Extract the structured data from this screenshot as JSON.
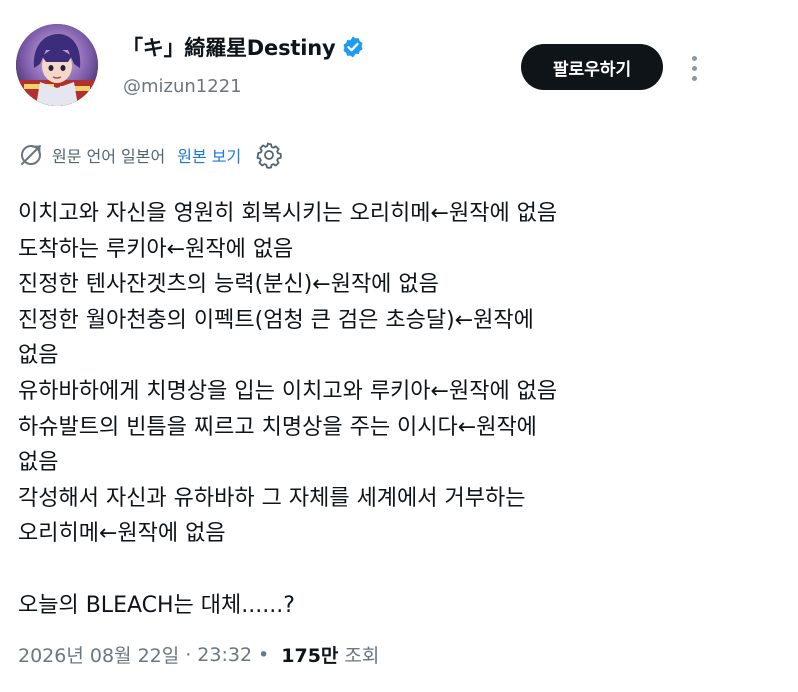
{
  "author": {
    "display_name": "「キ」綺羅星Destiny",
    "handle": "@mizun1221",
    "verified": true
  },
  "actions": {
    "follow_label": "팔로우하기",
    "more_icon": "more-vertical-icon"
  },
  "translation": {
    "icon": "translate-icon",
    "label": "원문 언어 일본어",
    "show_original": "원본 보기",
    "settings_icon": "gear-icon"
  },
  "tweet": {
    "lines": [
      "이치고와 자신을 영원히 회복시키는 오리히메←원작에 없음",
      "도착하는 루키아←원작에 없음",
      "진정한 텐사잔겟츠의 능력(분신)←원작에 없음",
      "진정한 월아천충의 이펙트(엄청 큰 검은 초승달)←원작에",
      "없음",
      "유하바하에게 치명상을 입는 이치고와 루키아←원작에 없음",
      "하슈발트의 빈틈을 찌르고 치명상을 주는 이시다←원작에",
      "없음",
      "각성해서 자신과 유하바하 그 자체를 세계에서 거부하는",
      "오리히메←원작에 없음",
      "",
      "오늘의 BLEACH는 대체......?"
    ]
  },
  "meta": {
    "date": "2026년 08월 22일",
    "time": "23:32",
    "separator": "·",
    "bullet": "•",
    "views": "175만",
    "views_label": "조회"
  },
  "colors": {
    "text": "#0f1419",
    "muted": "#6b7680",
    "link": "#1d78d6",
    "verified": "#1d9bf0",
    "button_bg": "#0f1419"
  }
}
